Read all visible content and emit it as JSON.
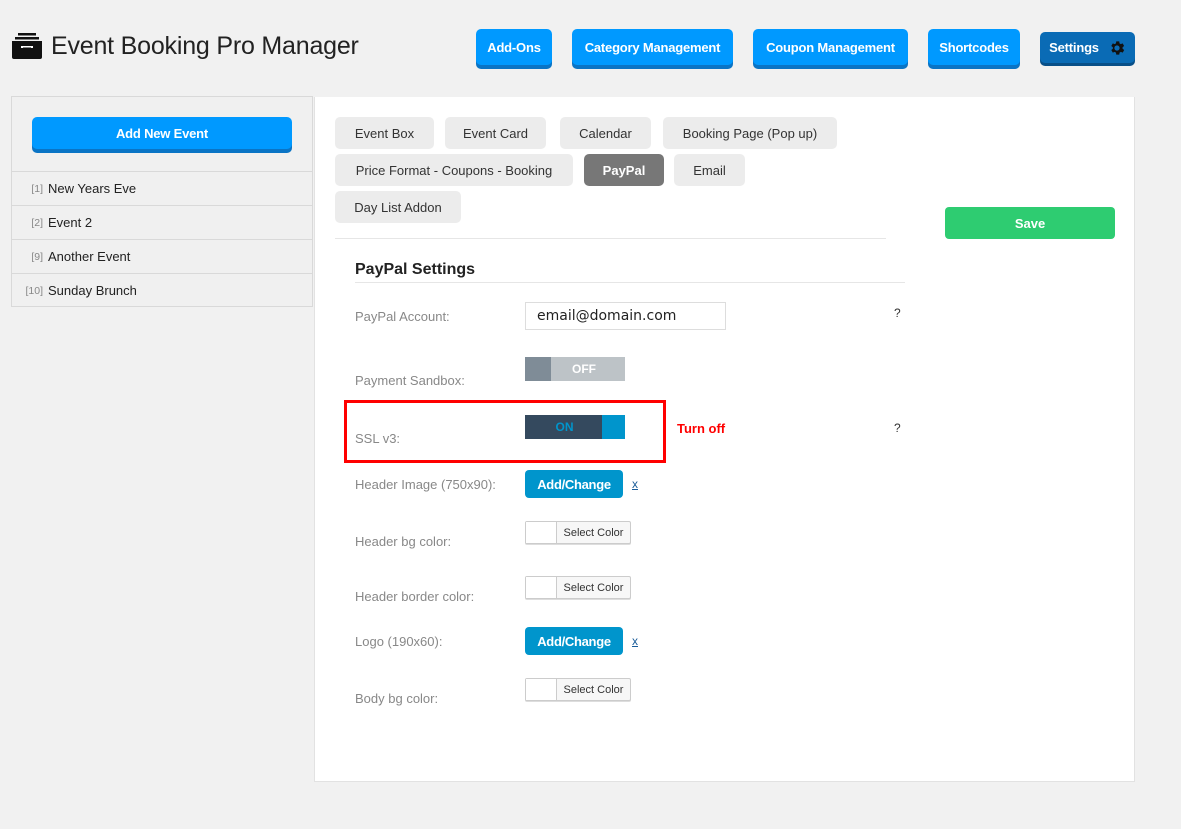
{
  "app": {
    "title": "Event Booking Pro Manager",
    "logo_icon": "archive-drawer-icon"
  },
  "topnav": [
    {
      "label": "Add-Ons"
    },
    {
      "label": "Category Management"
    },
    {
      "label": "Coupon Management"
    },
    {
      "label": "Shortcodes"
    },
    {
      "label": "Settings",
      "icon": "gear-icon",
      "active": true
    }
  ],
  "sidebar": {
    "add_button": "Add New Event",
    "events": [
      {
        "id": "[1]",
        "name": "New Years Eve"
      },
      {
        "id": "[2]",
        "name": "Event 2"
      },
      {
        "id": "[9]",
        "name": "Another Event"
      },
      {
        "id": "[10]",
        "name": "Sunday Brunch"
      }
    ]
  },
  "tabs": [
    {
      "label": "Event Box"
    },
    {
      "label": "Event Card"
    },
    {
      "label": "Calendar"
    },
    {
      "label": "Booking Page (Pop up)"
    },
    {
      "label": "Price Format - Coupons - Booking"
    },
    {
      "label": "PayPal",
      "active": true
    },
    {
      "label": "Email"
    },
    {
      "label": "Day List Addon"
    }
  ],
  "save_button": "Save",
  "section": {
    "title": "PayPal Settings",
    "fields": {
      "paypal_account": {
        "label": "PayPal Account:",
        "value": "email@domain.com",
        "help": "?"
      },
      "payment_sandbox": {
        "label": "Payment Sandbox:",
        "state": "OFF"
      },
      "ssl_v3": {
        "label": "SSL v3:",
        "state": "ON",
        "help": "?",
        "annotation": "Turn off"
      },
      "header_image": {
        "label": "Header Image (750x90):",
        "button": "Add/Change",
        "remove": "x"
      },
      "header_bg_color": {
        "label": "Header bg color:",
        "button": "Select Color"
      },
      "header_border_color": {
        "label": "Header border color:",
        "button": "Select Color"
      },
      "logo": {
        "label": "Logo (190x60):",
        "button": "Add/Change",
        "remove": "x"
      },
      "body_bg_color": {
        "label": "Body bg color:",
        "button": "Select Color"
      }
    }
  },
  "colors": {
    "primary_blue": "#0099ff",
    "settings_blue": "#0a6bb5",
    "save_green": "#2ecc71",
    "media_blue": "#0095cc",
    "annotation_red": "#ff0000",
    "active_tab": "#777777"
  }
}
